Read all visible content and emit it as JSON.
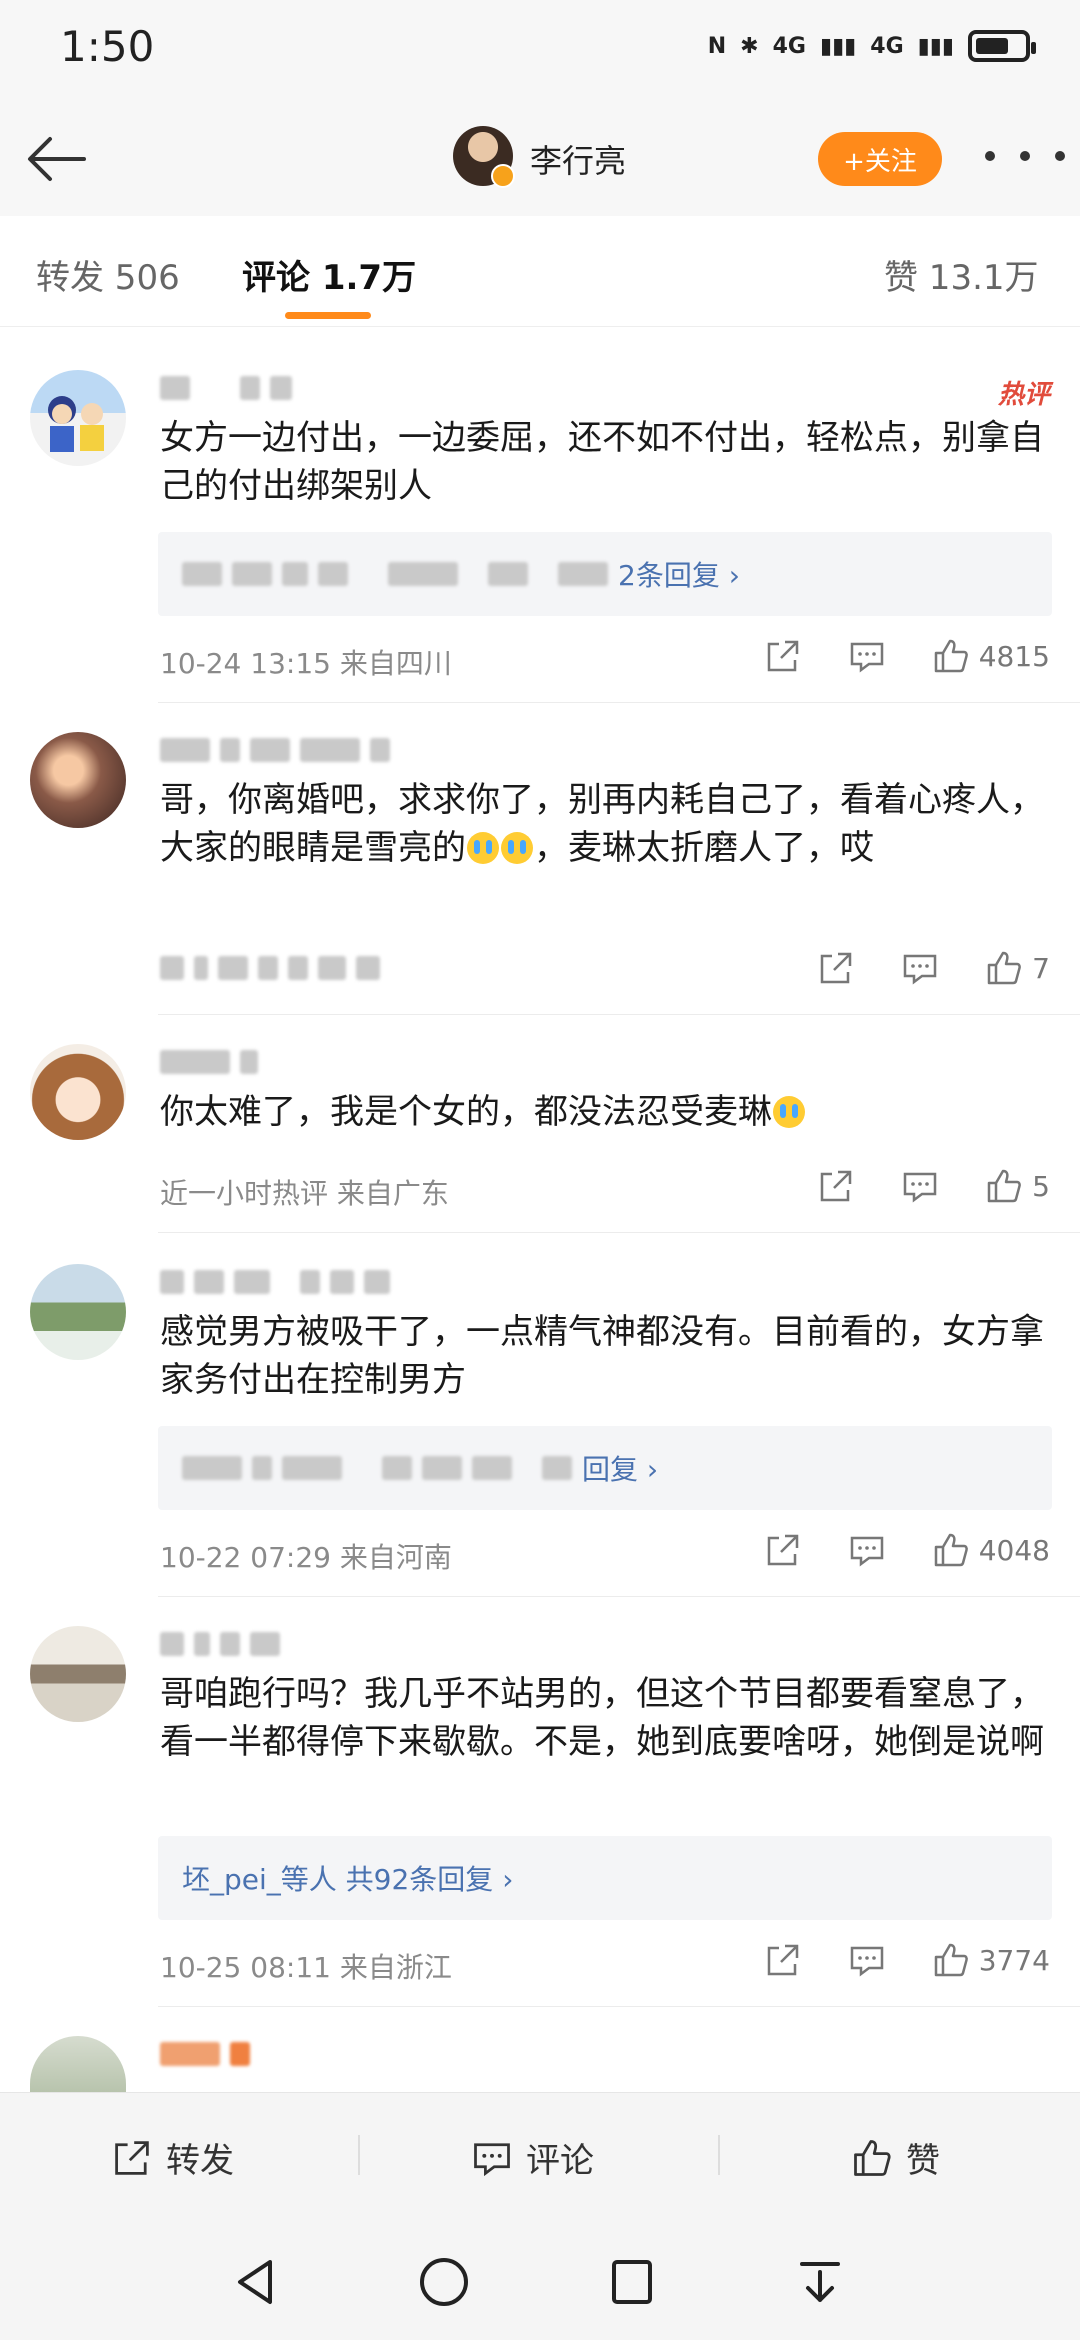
{
  "status_bar": {
    "time": "1:50",
    "network_1": "4G",
    "network_2": "4G"
  },
  "header": {
    "title": "李行亮",
    "follow_label": "+关注"
  },
  "tabs": [
    {
      "label": "转发 506"
    },
    {
      "label": "评论 1.7万"
    },
    {
      "label": "赞 13.1万"
    }
  ],
  "comments": [
    {
      "text": "女方一边付出，一边委屈，还不如不付出，轻松点，别拿自己的付出绑架别人",
      "badge": "热评",
      "reply_summary": "共2",
      "reply_suffix": "2条回复 ›",
      "meta": "10-24 13:15  来自四川",
      "likes": "4815"
    },
    {
      "text": "哥，你离婚吧，求求你了，别再内耗自己了，看着心疼人，大家的眼睛是雪亮的",
      "text_tail": "，麦琳太折磨人了，哎",
      "likes": "7"
    },
    {
      "text": "你太难了，我是个女的，都没法忍受麦琳",
      "meta": "近一小时热评  来自广东",
      "likes": "5"
    },
    {
      "text": "感觉男方被吸干了，一点精气神都没有。目前看的，女方拿家务付出在控制男方",
      "reply_suffix": "回复 ›",
      "meta": "10-22 07:29  来自河南",
      "likes": "4048"
    },
    {
      "text": "哥咱跑行吗？我几乎不站男的，但这个节目都要看窒息了，看一半都得停下来歇歇。不是，她到底要啥呀，她倒是说啊",
      "reply_summary": "坯_pei_等人  共92条回复 ›",
      "meta": "10-25 08:11  来自浙江",
      "likes": "3774"
    }
  ],
  "bottom_bar": {
    "repost": "转发",
    "comment": "评论",
    "like": "赞"
  },
  "colors": {
    "accent": "#ff8a1a",
    "link": "#4a72b0",
    "hot": "#e14b3b"
  }
}
